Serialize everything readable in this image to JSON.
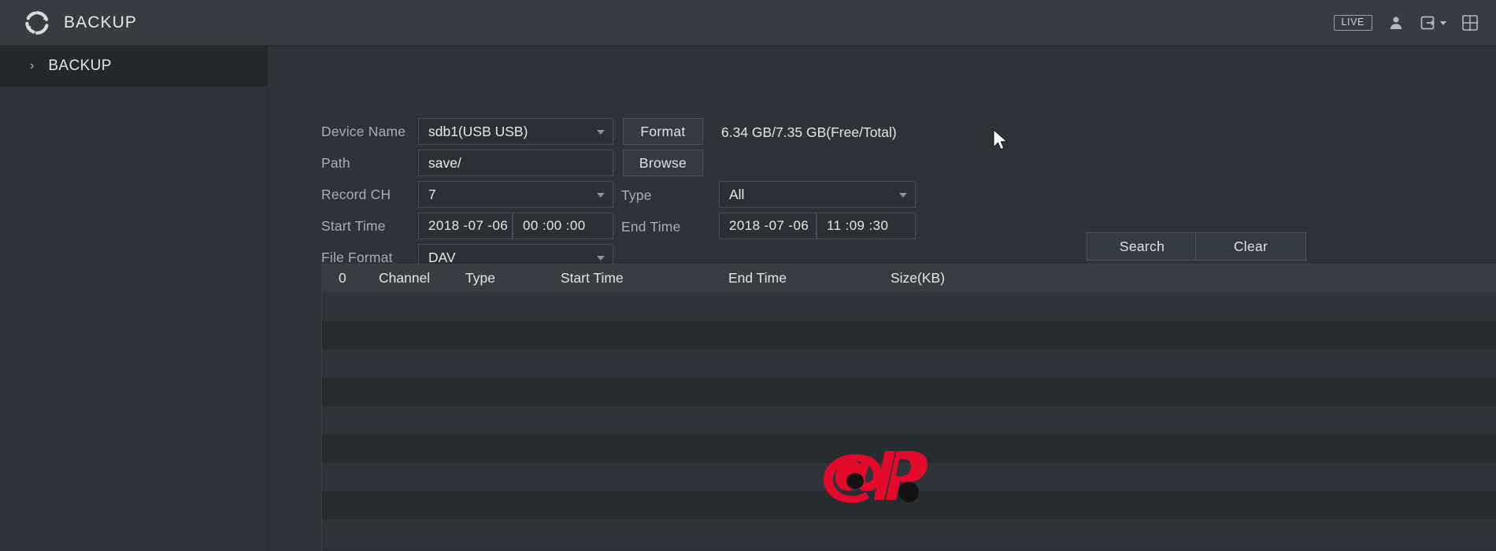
{
  "window": {
    "title": "BACKUP",
    "logo_icon": "refresh-circle-icon"
  },
  "titlebar_right": {
    "live_badge": "LIVE",
    "user_icon": "user-icon",
    "logout_icon": "logout-icon",
    "grid_icon": "grid-icon"
  },
  "sidebar": {
    "items": [
      {
        "label": "BACKUP",
        "chevron": "›",
        "selected": true
      }
    ]
  },
  "form": {
    "device_name": {
      "label": "Device Name",
      "value": "sdb1(USB USB)",
      "button": "Format",
      "capacity": "6.34 GB/7.35 GB(Free/Total)"
    },
    "path": {
      "label": "Path",
      "value": "save/",
      "button": "Browse"
    },
    "record_ch": {
      "label": "Record CH",
      "value": "7"
    },
    "type": {
      "label": "Type",
      "value": "All"
    },
    "start_time": {
      "label": "Start Time",
      "date": "2018 -07 -06",
      "time": "00 :00 :00"
    },
    "end_time": {
      "label": "End Time",
      "date": "2018 -07 -06",
      "time": "11 :09 :30"
    },
    "file_format": {
      "label": "File Format",
      "value": "DAV"
    },
    "search_button": "Search",
    "clear_button": "Clear"
  },
  "table": {
    "headers": {
      "index": "0",
      "channel": "Channel",
      "type": "Type",
      "start_time": "Start Time",
      "end_time": "End Time",
      "size": "Size(KB)"
    },
    "rows": []
  },
  "colors": {
    "accent_red": "#e3092a",
    "panel_bg": "#2e3339",
    "titlebar_bg": "#373c43",
    "field_bg": "#2b3036",
    "field_border": "#474d55"
  }
}
